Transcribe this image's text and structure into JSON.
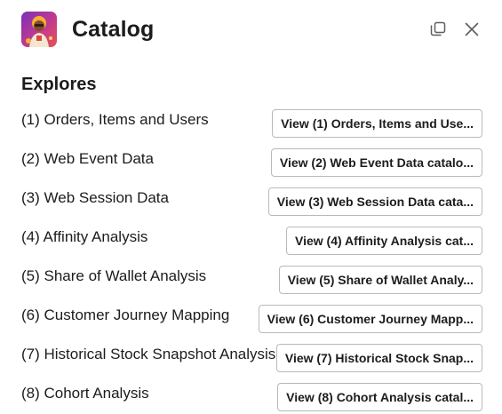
{
  "header": {
    "title": "Catalog"
  },
  "section": {
    "heading": "Explores"
  },
  "explores": [
    {
      "label": "(1) Orders, Items and Users",
      "button": "View (1) Orders, Items and Use..."
    },
    {
      "label": "(2) Web Event Data",
      "button": "View (2) Web Event Data catalo..."
    },
    {
      "label": "(3) Web Session Data",
      "button": "View (3) Web Session Data cata..."
    },
    {
      "label": "(4) Affinity Analysis",
      "button": "View (4) Affinity Analysis cat..."
    },
    {
      "label": "(5) Share of Wallet Analysis",
      "button": "View (5) Share of Wallet Analy..."
    },
    {
      "label": "(6) Customer Journey Mapping",
      "button": "View (6) Customer Journey Mapp..."
    },
    {
      "label": "(7) Historical Stock Snapshot Analysis",
      "button": "View (7) Historical Stock Snap..."
    },
    {
      "label": "(8) Cohort Analysis",
      "button": "View (8) Cohort Analysis catal..."
    }
  ],
  "icons": {
    "avatar": "app-avatar-icon",
    "popout": "popout-icon",
    "close": "close-icon"
  }
}
